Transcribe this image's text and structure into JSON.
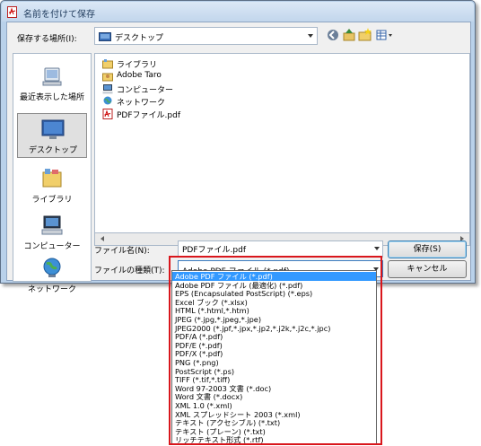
{
  "window": {
    "title": "名前を付けて保存"
  },
  "toolbar": {
    "save_in_label": "保存する場所(I):",
    "location": "デスクトップ",
    "icons": [
      "back-icon",
      "up-folder-icon",
      "new-folder-icon",
      "view-menu-icon"
    ]
  },
  "places": [
    {
      "label": "最近表示した場所",
      "icon": "recent-places-icon"
    },
    {
      "label": "デスクトップ",
      "icon": "desktop-icon",
      "selected": true
    },
    {
      "label": "ライブラリ",
      "icon": "libraries-icon"
    },
    {
      "label": "コンピューター",
      "icon": "computer-icon"
    },
    {
      "label": "ネットワーク",
      "icon": "network-icon"
    }
  ],
  "files": [
    {
      "name": "ライブラリ",
      "icon": "library-icon"
    },
    {
      "name": "Adobe Taro",
      "icon": "user-folder-icon"
    },
    {
      "name": "コンピューター",
      "icon": "computer-icon"
    },
    {
      "name": "ネットワーク",
      "icon": "network-icon"
    },
    {
      "name": "PDFファイル.pdf",
      "icon": "pdf-file-icon"
    }
  ],
  "form": {
    "filename_label": "ファイル名(N):",
    "filename_value": "PDFファイル.pdf",
    "filetype_label": "ファイルの種類(T):",
    "filetype_value": "Adobe PDF ファイル (*.pdf)"
  },
  "buttons": {
    "save": "保存(S)",
    "cancel": "キャンセル"
  },
  "filetype_options": [
    "Adobe PDF ファイル (*.pdf)",
    "Adobe PDF ファイル (最適化) (*.pdf)",
    "EPS (Encapsulated PostScript) (*.eps)",
    "Excel ブック (*.xlsx)",
    "HTML (*.html,*.htm)",
    "JPEG (*.jpg,*.jpeg,*.jpe)",
    "JPEG2000 (*.jpf,*.jpx,*.jp2,*.j2k,*.j2c,*.jpc)",
    "PDF/A (*.pdf)",
    "PDF/E (*.pdf)",
    "PDF/X (*.pdf)",
    "PNG (*.png)",
    "PostScript (*.ps)",
    "TIFF (*.tif,*.tiff)",
    "Word 97-2003 文書 (*.doc)",
    "Word 文書 (*.docx)",
    "XML 1.0 (*.xml)",
    "XML スプレッドシート 2003 (*.xml)",
    "テキスト (アクセシブル) (*.txt)",
    "テキスト (プレーン) (*.txt)",
    "リッチテキスト形式 (*.rtf)"
  ],
  "selected_option_index": 0,
  "colors": {
    "selection": "#3399ff",
    "highlight_border": "#d9161c",
    "title_bar": "#c2d6ec"
  }
}
